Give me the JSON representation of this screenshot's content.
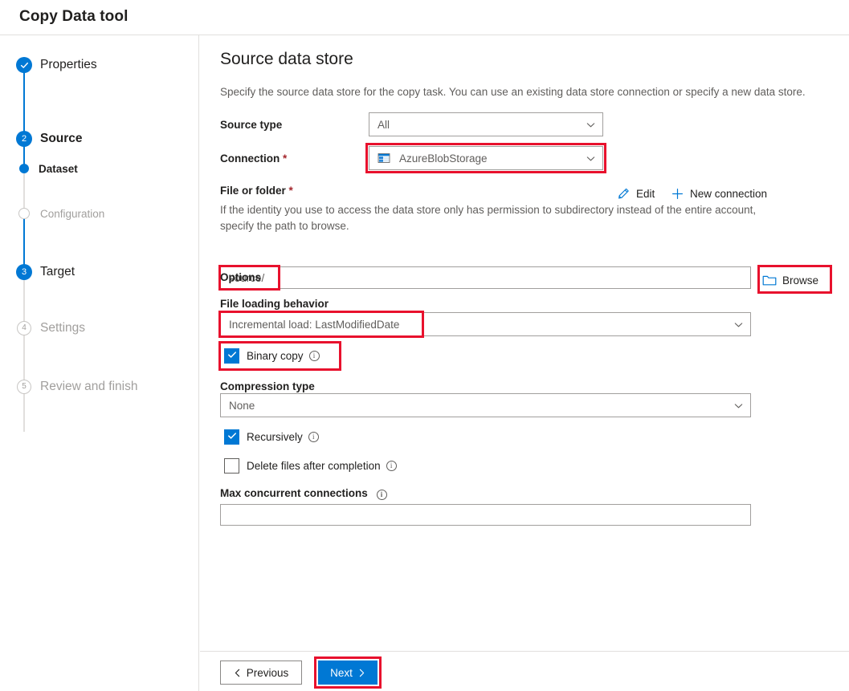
{
  "window": {
    "title": "Copy Data tool"
  },
  "wizard": {
    "steps": [
      {
        "label": "Properties",
        "marker": "check",
        "state": "completed",
        "icon": "check-icon"
      },
      {
        "label": "Source",
        "marker": "2",
        "state": "active",
        "icon": "step-number-2"
      },
      {
        "label": "Dataset",
        "marker": "dot",
        "state": "active-sub",
        "icon": "dot-icon"
      },
      {
        "label": "Configuration",
        "marker": "hollow",
        "state": "pending-sub",
        "icon": "hollow-circle-icon"
      },
      {
        "label": "Target",
        "marker": "3",
        "state": "upcoming",
        "icon": "step-number-3"
      },
      {
        "label": "Settings",
        "marker": "4",
        "state": "disabled",
        "icon": "step-number-4"
      },
      {
        "label": "Review and finish",
        "marker": "5",
        "state": "disabled",
        "icon": "step-number-5"
      }
    ]
  },
  "page": {
    "title": "Source data store",
    "description": "Specify the source data store for the copy task. You can use an existing data store connection or specify a new data store."
  },
  "form": {
    "source_type": {
      "label": "Source type",
      "value": "All"
    },
    "connection": {
      "label": "Connection",
      "required_mark": "*",
      "value": "AzureBlobStorage",
      "icon": "azure-blob-storage-icon",
      "edit_label": "Edit",
      "new_connection_label": "New connection"
    },
    "file_or_folder": {
      "label": "File or folder",
      "required_mark": "*",
      "helper": "If the identity you use to access the data store only has permission to subdirectory instead of the entire account, specify the path to browse.",
      "value": "source/",
      "browse_label": "Browse"
    },
    "options_heading": "Options",
    "file_loading_behavior": {
      "label": "File loading behavior",
      "value": "Incremental load: LastModifiedDate"
    },
    "binary_copy": {
      "label": "Binary copy",
      "checked": true,
      "info": "info-icon"
    },
    "compression_type": {
      "label": "Compression type",
      "value": "None"
    },
    "recursively": {
      "label": "Recursively",
      "checked": true,
      "info": "info-icon"
    },
    "delete_files_after_completion": {
      "label": "Delete files after completion",
      "checked": false,
      "info": "info-icon"
    },
    "max_concurrent_connections": {
      "label": "Max concurrent connections",
      "value": "",
      "info": "info-icon"
    }
  },
  "footer": {
    "previous_label": "Previous",
    "next_label": "Next"
  },
  "colors": {
    "accent": "#0078d4",
    "highlight": "#e8112d",
    "required": "#a4262c",
    "muted_text": "#605e5c",
    "disabled_text": "#a19f9d",
    "border": "#a19f9d"
  }
}
